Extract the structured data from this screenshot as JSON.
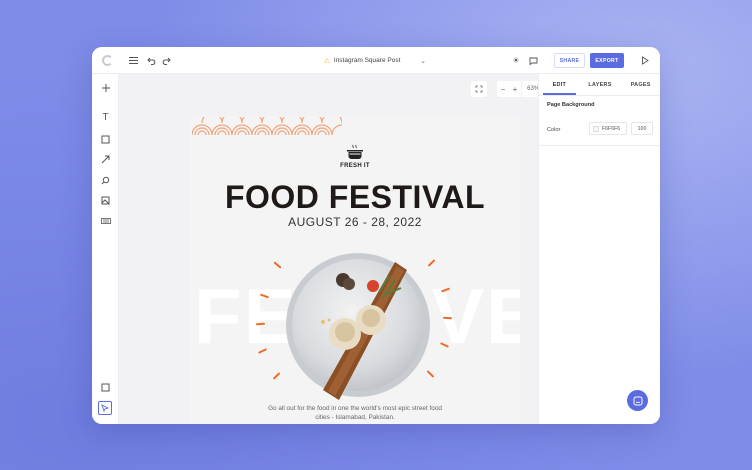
{
  "app": {
    "document_title": "Instagram Square Post",
    "share_label": "SHARE",
    "export_label": "EXPORT",
    "zoom_level": "63%"
  },
  "icons": {
    "logo": "app-logo-icon",
    "menu": "hamburger-menu-icon",
    "undo": "undo-icon",
    "redo": "redo-icon",
    "warning": "warning-icon",
    "theme": "sun-icon",
    "comments": "chat-icon",
    "preview": "play-icon"
  },
  "left_tools": [
    {
      "name": "add",
      "glyph": "+"
    },
    {
      "name": "text",
      "glyph": "T"
    },
    {
      "name": "shape",
      "glyph": "□"
    },
    {
      "name": "line",
      "glyph": "↗"
    },
    {
      "name": "search-image",
      "glyph": "⌕"
    },
    {
      "name": "image",
      "glyph": "▨"
    },
    {
      "name": "qr",
      "glyph": "▤"
    }
  ],
  "left_bottom_tools": [
    {
      "name": "resize",
      "glyph": "◻"
    },
    {
      "name": "select",
      "glyph": "➤"
    },
    {
      "name": "keyboard",
      "glyph": "⌨"
    },
    {
      "name": "plugins",
      "glyph": "✣"
    }
  ],
  "poster": {
    "brand": "FRESH IT",
    "headline": "FOOD FESTIVAL",
    "date": "AUGUST  26 - 28, 2022",
    "big_word_left": "FE",
    "big_word_right": "VE",
    "description": "Go all out for the food in one the world's most epic street food cities - Islamabad, Pakistan.",
    "accent_color": "#ef6a25",
    "headline_color": "#1f1a17"
  },
  "panel": {
    "tabs": [
      "EDIT",
      "LAYERS",
      "PAGES"
    ],
    "active_tab": "EDIT",
    "section_title": "Page Background",
    "color_label": "Color",
    "color_value": "F6F6F6",
    "opacity_value": "100"
  },
  "theme": {
    "accent": "#5b6be0",
    "background": "#7f8ce8"
  }
}
